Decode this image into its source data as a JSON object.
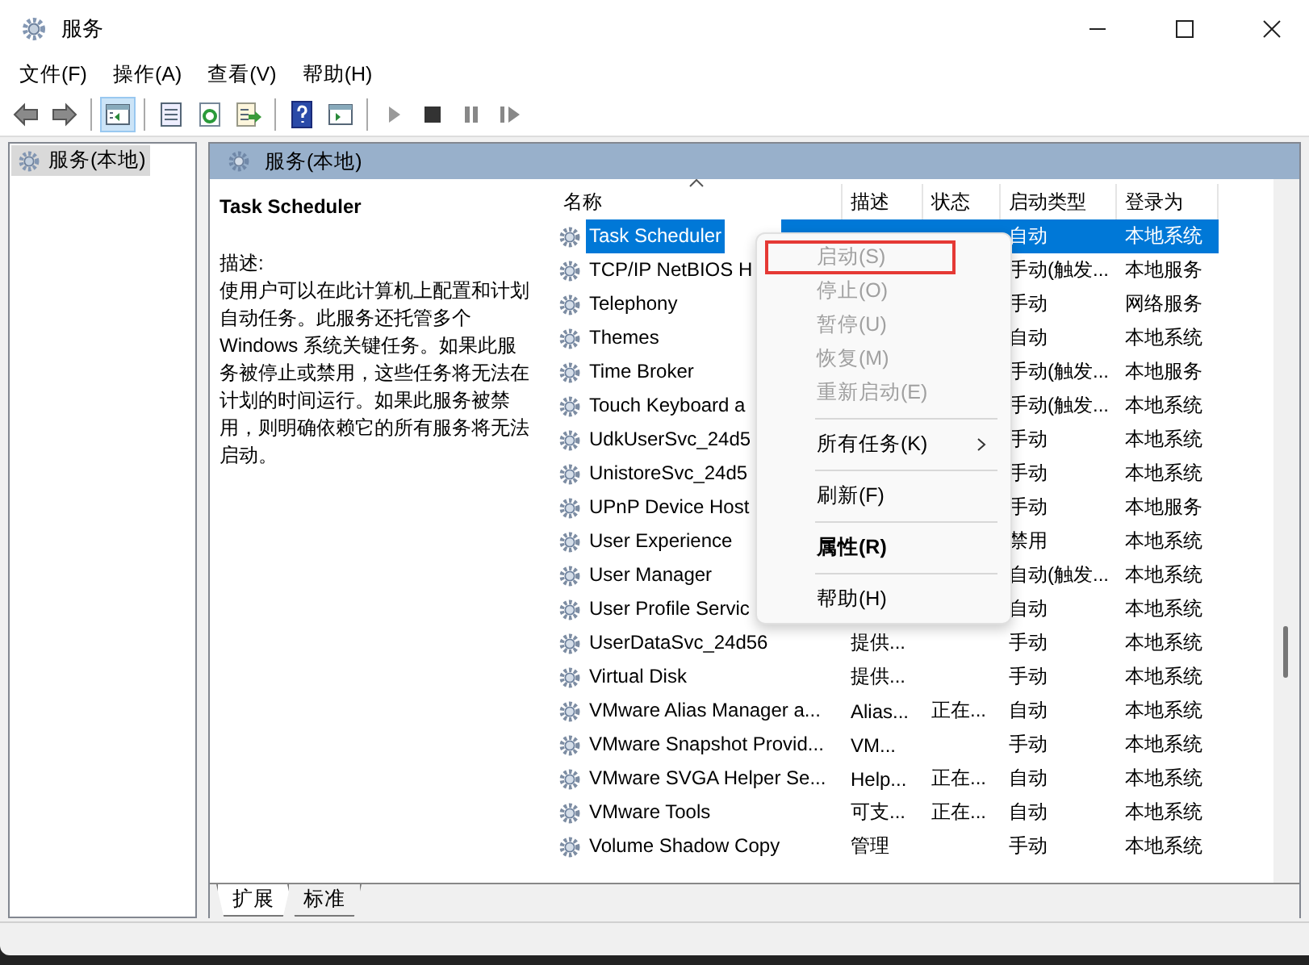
{
  "window": {
    "title": "服务"
  },
  "menubar": [
    "文件(F)",
    "操作(A)",
    "查看(V)",
    "帮助(H)"
  ],
  "toolbar": [
    [
      {
        "kind": "back",
        "pressed": false
      },
      {
        "kind": "forward",
        "pressed": false
      }
    ],
    [
      {
        "kind": "console-tree",
        "pressed": true
      }
    ],
    [
      {
        "kind": "properties",
        "pressed": false
      },
      {
        "kind": "refresh",
        "pressed": false
      },
      {
        "kind": "export",
        "pressed": false
      }
    ],
    [
      {
        "kind": "help",
        "pressed": false
      },
      {
        "kind": "view",
        "pressed": false
      }
    ],
    [
      {
        "kind": "play",
        "pressed": false,
        "disabled": true
      },
      {
        "kind": "stop",
        "pressed": false,
        "disabled": false
      },
      {
        "kind": "pause",
        "pressed": false,
        "disabled": true
      },
      {
        "kind": "resume",
        "pressed": false,
        "disabled": true
      }
    ]
  ],
  "tree": [
    {
      "label": "服务(本地)",
      "selected": true
    }
  ],
  "panel": {
    "title": "服务(本地)"
  },
  "details": {
    "title": "Task Scheduler",
    "label": "描述:",
    "text": "使用户可以在此计算机上配置和计划自动任务。此服务还托管多个 Windows 系统关键任务。如果此服务被停止或禁用，这些任务将无法在计划的时间运行。如果此服务被禁用，则明确依赖它的所有服务将无法启动。"
  },
  "table": {
    "columns": [
      "名称",
      "描述",
      "状态",
      "启动类型",
      "登录为"
    ],
    "rows": [
      {
        "name": "Task Scheduler",
        "desc": "",
        "status": "",
        "start": "自动",
        "login": "本地系统",
        "selected": true
      },
      {
        "name": "TCP/IP NetBIOS H",
        "desc": "",
        "status": "",
        "start": "手动(触发...",
        "login": "本地服务",
        "selected": false
      },
      {
        "name": "Telephony",
        "desc": "",
        "status": "",
        "start": "手动",
        "login": "网络服务",
        "selected": false
      },
      {
        "name": "Themes",
        "desc": "",
        "status": "",
        "start": "自动",
        "login": "本地系统",
        "selected": false
      },
      {
        "name": "Time Broker",
        "desc": "",
        "status": "",
        "start": "手动(触发...",
        "login": "本地服务",
        "selected": false
      },
      {
        "name": "Touch Keyboard a",
        "desc": "",
        "status": "",
        "start": "手动(触发...",
        "login": "本地系统",
        "selected": false
      },
      {
        "name": "UdkUserSvc_24d5",
        "desc": "",
        "status": "",
        "start": "手动",
        "login": "本地系统",
        "selected": false
      },
      {
        "name": "UnistoreSvc_24d5",
        "desc": "",
        "status": "",
        "start": "手动",
        "login": "本地系统",
        "selected": false
      },
      {
        "name": "UPnP Device Host",
        "desc": "",
        "status": "",
        "start": "手动",
        "login": "本地服务",
        "selected": false
      },
      {
        "name": "User Experience",
        "desc": "",
        "status": "",
        "start": "禁用",
        "login": "本地系统",
        "selected": false
      },
      {
        "name": "User Manager",
        "desc": "",
        "status": "",
        "start": "自动(触发...",
        "login": "本地系统",
        "selected": false
      },
      {
        "name": "User Profile Servic",
        "desc": "",
        "status": "",
        "start": "自动",
        "login": "本地系统",
        "selected": false
      },
      {
        "name": "UserDataSvc_24d56",
        "desc": "提供...",
        "status": "",
        "start": "手动",
        "login": "本地系统",
        "selected": false
      },
      {
        "name": "Virtual Disk",
        "desc": "提供...",
        "status": "",
        "start": "手动",
        "login": "本地系统",
        "selected": false
      },
      {
        "name": "VMware Alias Manager a...",
        "desc": "Alias...",
        "status": "正在...",
        "start": "自动",
        "login": "本地系统",
        "selected": false
      },
      {
        "name": "VMware Snapshot Provid...",
        "desc": "VM...",
        "status": "",
        "start": "手动",
        "login": "本地系统",
        "selected": false
      },
      {
        "name": "VMware SVGA Helper Se...",
        "desc": "Help...",
        "status": "正在...",
        "start": "自动",
        "login": "本地系统",
        "selected": false
      },
      {
        "name": "VMware Tools",
        "desc": "可支...",
        "status": "正在...",
        "start": "自动",
        "login": "本地系统",
        "selected": false
      },
      {
        "name": "Volume Shadow Copy",
        "desc": "管理",
        "status": "",
        "start": "手动",
        "login": "本地系统",
        "selected": false
      }
    ]
  },
  "context_menu": [
    [
      {
        "label": "启动(S)",
        "disabled": true,
        "outlined": true,
        "default": false,
        "submenu": false
      },
      {
        "label": "停止(O)",
        "disabled": true,
        "outlined": false,
        "default": false,
        "submenu": false
      },
      {
        "label": "暂停(U)",
        "disabled": true,
        "outlined": false,
        "default": false,
        "submenu": false
      },
      {
        "label": "恢复(M)",
        "disabled": true,
        "outlined": false,
        "default": false,
        "submenu": false
      },
      {
        "label": "重新启动(E)",
        "disabled": true,
        "outlined": false,
        "default": false,
        "submenu": false
      }
    ],
    [
      {
        "label": "所有任务(K)",
        "disabled": false,
        "outlined": false,
        "default": false,
        "submenu": true
      }
    ],
    [
      {
        "label": "刷新(F)",
        "disabled": false,
        "outlined": false,
        "default": false,
        "submenu": false
      }
    ],
    [
      {
        "label": "属性(R)",
        "disabled": false,
        "outlined": false,
        "default": true,
        "submenu": false
      }
    ],
    [
      {
        "label": "帮助(H)",
        "disabled": false,
        "outlined": false,
        "default": false,
        "submenu": false
      }
    ]
  ],
  "tabs": [
    {
      "label": "扩展",
      "selected": true
    },
    {
      "label": "标准",
      "selected": false
    }
  ]
}
